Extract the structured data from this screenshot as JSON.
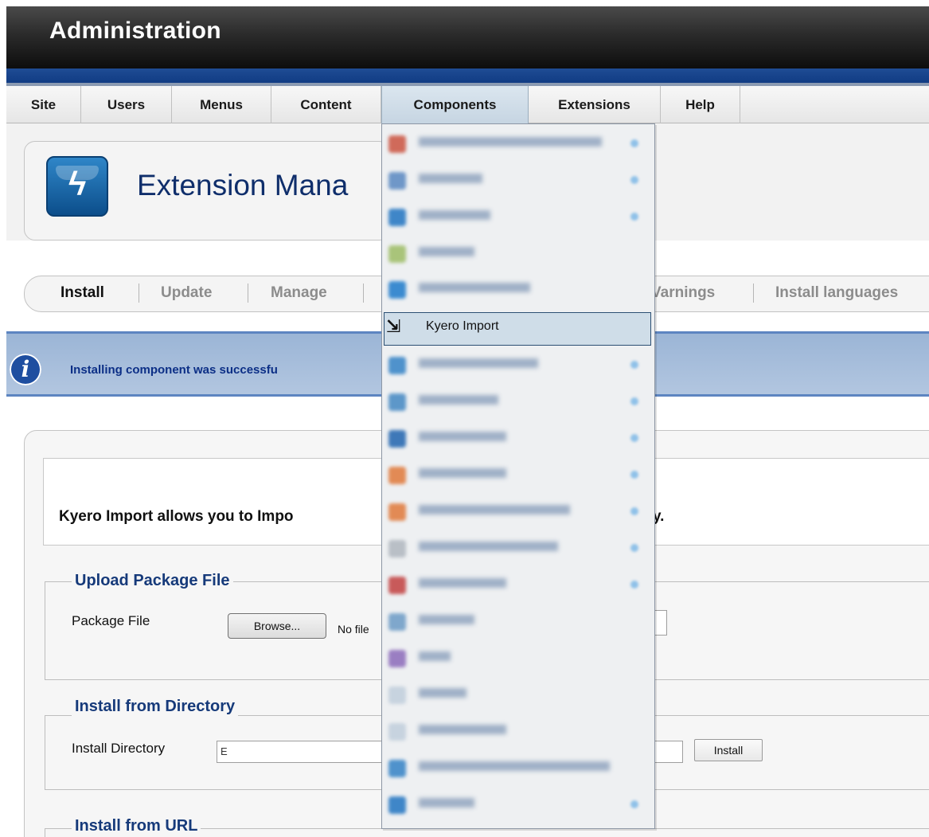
{
  "header": {
    "title": "Administration"
  },
  "menubar": {
    "items": [
      {
        "label": "Site"
      },
      {
        "label": "Users"
      },
      {
        "label": "Menus"
      },
      {
        "label": "Content"
      },
      {
        "label": "Components"
      },
      {
        "label": "Extensions"
      },
      {
        "label": "Help"
      }
    ],
    "active": "Components"
  },
  "page": {
    "title": "Extension Mana",
    "icon": "lightning-bolt-icon"
  },
  "subtabs": {
    "items": [
      {
        "label": "Install"
      },
      {
        "label": "Update"
      },
      {
        "label": "Manage"
      },
      {
        "label": "Varnings"
      },
      {
        "label": "Install languages"
      }
    ],
    "active": "Install"
  },
  "message": {
    "icon": "info-icon",
    "text": "Installing component was successfu"
  },
  "description": {
    "text": "Kyero Import allows you to Impo",
    "tail": "y."
  },
  "upload": {
    "legend": "Upload Package File",
    "label": "Package File",
    "browse_label": "Browse...",
    "no_file_text": "No file"
  },
  "directory": {
    "legend": "Install from Directory",
    "label": "Install Directory",
    "value": "E",
    "install_label": "Install"
  },
  "url": {
    "legend": "Install from URL"
  },
  "components_dropdown": {
    "selected_label": "Kyero Import",
    "selected_icon": "import-icon"
  },
  "colors": {
    "header_bg": "#1a1a1a",
    "brand_blue": "#0f3a82",
    "message_bg": "#a6bedc",
    "title_text": "#0f2e6b"
  }
}
